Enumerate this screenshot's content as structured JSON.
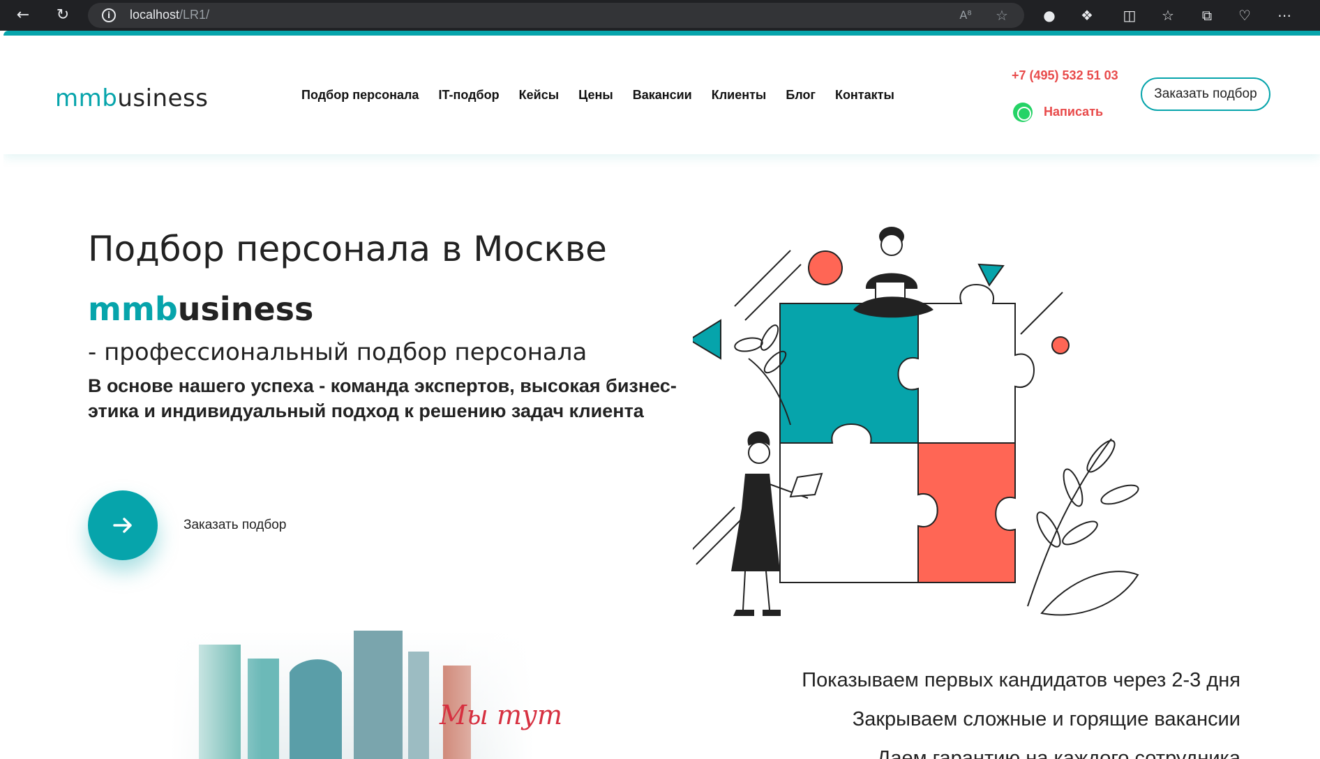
{
  "browser": {
    "url_host": "localhost",
    "url_path": "/LR1/"
  },
  "header": {
    "logo_accent": "mmb",
    "logo_rest": "usiness",
    "nav": [
      "Подбор персонала",
      "IT-подбор",
      "Кейсы",
      "Цены",
      "Вакансии",
      "Клиенты",
      "Блог",
      "Контакты"
    ],
    "phone": "+7 (495) 532 51 03",
    "write_label": "Написать",
    "order_button": "Заказать подбор"
  },
  "hero": {
    "title": "Подбор персонала в Москве",
    "brand_accent": "mmb",
    "brand_rest": "usiness",
    "subtitle": "- профессиональный подбор персонала",
    "text": "В основе нашего успеха - команда экспертов, высокая бизнес-этика и индивидуальный подход к решению задач клиента",
    "cta_label": "Заказать подбор"
  },
  "lower": {
    "photo_caption": "Мы тут",
    "features": [
      "Показываем первых кандидатов через 2-3 дня",
      "Закрываем сложные и горящие вакансии",
      "Даем гарантию на каждого сотрудника"
    ]
  },
  "colors": {
    "accent": "#06a4ab",
    "red": "#e84a4a",
    "coral": "#ff6655",
    "text": "#222222"
  }
}
